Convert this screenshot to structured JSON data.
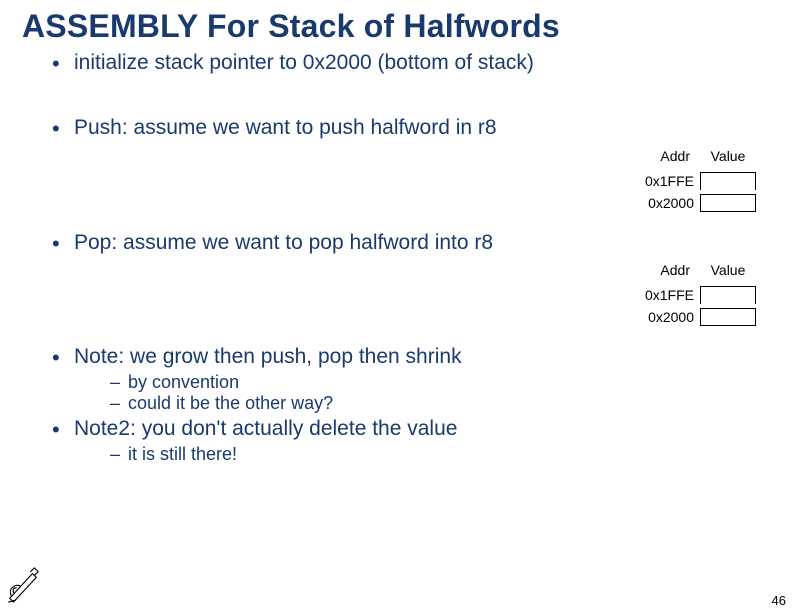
{
  "title": "ASSEMBLY For Stack of Halfwords",
  "bullets": {
    "b1": "initialize stack pointer to 0x2000 (bottom of stack)",
    "b2": "Push: assume we want to push halfword in r8",
    "b3": "Pop: assume we want to pop halfword into r8",
    "b4": "Note: we grow then push, pop then shrink",
    "b4_subs": {
      "s1": "by convention",
      "s2": "could it be the other way?"
    },
    "b5": "Note2: you don't actually delete the value",
    "b5_subs": {
      "s1": "it is still there!"
    }
  },
  "memtable1": {
    "headers": {
      "addr": "Addr",
      "value": "Value"
    },
    "rows": {
      "r1": "0x1FFE",
      "r2": "0x2000"
    }
  },
  "memtable2": {
    "headers": {
      "addr": "Addr",
      "value": "Value"
    },
    "rows": {
      "r1": "0x1FFE",
      "r2": "0x2000"
    }
  },
  "page_number": "46"
}
